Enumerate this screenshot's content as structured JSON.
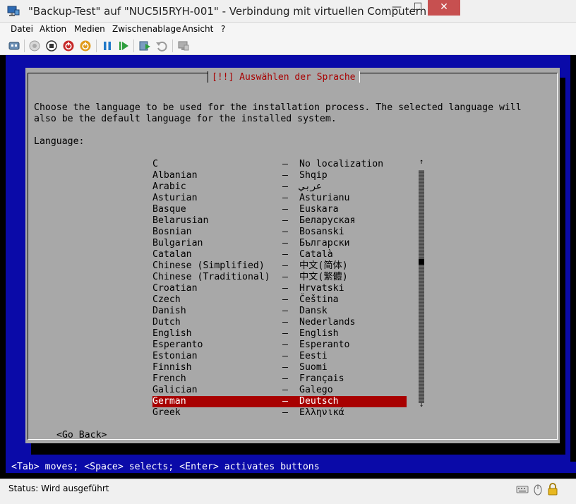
{
  "window": {
    "title": "\"Backup-Test\" auf \"NUC5I5RYH-001\" - Verbindung mit virtuellen Computern",
    "minimize_label": "—",
    "maximize_label": "☐",
    "close_label": "✕"
  },
  "menu": {
    "items": [
      "Datei",
      "Aktion",
      "Medien",
      "Zwischenablage",
      "Ansicht",
      "?"
    ]
  },
  "toolbar": {
    "icons": [
      "ctrl-alt-del-icon",
      "start-icon",
      "turn-off-icon",
      "shutdown-icon",
      "save-state-icon",
      "pause-icon",
      "resume-icon",
      "checkpoint-icon",
      "revert-icon",
      "enhanced-session-icon"
    ]
  },
  "installer": {
    "dialog_title": "[!!] Auswählen der Sprache",
    "description_line1": "Choose the language to be used for the installation process. The selected language will",
    "description_line2": "also be the default language for the installed system.",
    "language_label": "Language:",
    "separator": "–",
    "languages": [
      {
        "name": "C",
        "native": "No localization"
      },
      {
        "name": "Albanian",
        "native": "Shqip"
      },
      {
        "name": "Arabic",
        "native": "عربي"
      },
      {
        "name": "Asturian",
        "native": "Asturianu"
      },
      {
        "name": "Basque",
        "native": "Euskara"
      },
      {
        "name": "Belarusian",
        "native": "Беларуская"
      },
      {
        "name": "Bosnian",
        "native": "Bosanski"
      },
      {
        "name": "Bulgarian",
        "native": "Български"
      },
      {
        "name": "Catalan",
        "native": "Català"
      },
      {
        "name": "Chinese (Simplified)",
        "native": "中文(简体)"
      },
      {
        "name": "Chinese (Traditional)",
        "native": "中文(繁體)"
      },
      {
        "name": "Croatian",
        "native": "Hrvatski"
      },
      {
        "name": "Czech",
        "native": "Čeština"
      },
      {
        "name": "Danish",
        "native": "Dansk"
      },
      {
        "name": "Dutch",
        "native": "Nederlands"
      },
      {
        "name": "English",
        "native": "English"
      },
      {
        "name": "Esperanto",
        "native": "Esperanto"
      },
      {
        "name": "Estonian",
        "native": "Eesti"
      },
      {
        "name": "Finnish",
        "native": "Suomi"
      },
      {
        "name": "French",
        "native": "Français"
      },
      {
        "name": "Galician",
        "native": "Galego"
      },
      {
        "name": "German",
        "native": "Deutsch",
        "selected": true
      },
      {
        "name": "Greek",
        "native": "Ελληνικά"
      }
    ],
    "scroll_up": "↑",
    "scroll_down": "↓",
    "go_back_label": "<Go Back>",
    "hint": "<Tab> moves; <Space> selects; <Enter> activates buttons"
  },
  "status": {
    "text": "Status: Wird ausgeführt"
  }
}
